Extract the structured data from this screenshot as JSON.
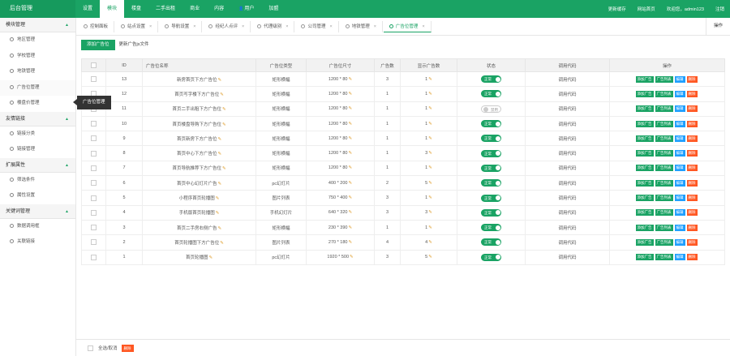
{
  "app": {
    "brand": "后台管理"
  },
  "topnav": [
    {
      "label": "设置",
      "active": false
    },
    {
      "label": "模块",
      "active": true
    },
    {
      "label": "楼盘",
      "active": false
    },
    {
      "label": "二手出租",
      "active": false
    },
    {
      "label": "商业",
      "active": false
    },
    {
      "label": "内容",
      "active": false
    },
    {
      "label": "用户",
      "active": false,
      "icon": "user-icon"
    },
    {
      "label": "加盟",
      "active": false
    }
  ],
  "topright": {
    "clear_cache": "更新缓存",
    "site_home": "网站首页",
    "welcome": "欢迎您，admin123",
    "logout": "注销"
  },
  "sidebar": {
    "groups": [
      {
        "title": "模块管理",
        "items": [
          {
            "label": "地区管理",
            "active": false
          },
          {
            "label": "学校管理",
            "active": false
          },
          {
            "label": "地铁管理",
            "active": false
          },
          {
            "label": "广告位管理",
            "active": true
          },
          {
            "label": "楼盘价管理",
            "active": false
          }
        ]
      },
      {
        "title": "友情链接",
        "items": [
          {
            "label": "链接分类",
            "active": false
          },
          {
            "label": "链接管理",
            "active": false
          }
        ]
      },
      {
        "title": "扩展属性",
        "items": [
          {
            "label": "筛选条件",
            "active": false
          },
          {
            "label": "属性设置",
            "active": false
          }
        ]
      },
      {
        "title": "关键词管理",
        "items": [
          {
            "label": "数据调用框",
            "active": false
          },
          {
            "label": "关联链接",
            "active": false
          }
        ]
      }
    ]
  },
  "tooltip": {
    "text": "广告位管理"
  },
  "tabs": [
    {
      "label": "控制面板",
      "active": false,
      "closable": false
    },
    {
      "label": "站点设置",
      "active": false,
      "closable": true
    },
    {
      "label": "导航设置",
      "active": false,
      "closable": true
    },
    {
      "label": "经纪人点评",
      "active": false,
      "closable": true
    },
    {
      "label": "代理级别",
      "active": false,
      "closable": true
    },
    {
      "label": "公司管理",
      "active": false,
      "closable": true
    },
    {
      "label": "地铁管理",
      "active": false,
      "closable": true
    },
    {
      "label": "广告位管理",
      "active": true,
      "closable": true
    }
  ],
  "tab_ops_label": "操作",
  "toolbar": {
    "add_label": "添加广告位",
    "refresh_label": "更新广告js文件"
  },
  "table": {
    "headers": [
      "",
      "ID",
      "广告位名称",
      "广告位类型",
      "广告位尺寸",
      "广告数",
      "显示广告数",
      "状态",
      "调用代码",
      "操作"
    ],
    "rows": [
      {
        "id": "13",
        "name": "新房首页下方广告位",
        "type": "矩形横幅",
        "size": "1200 * 80",
        "count": "3",
        "show": "1",
        "on": true,
        "code": "调用代码"
      },
      {
        "id": "12",
        "name": "首页写字楼下方广告位",
        "type": "矩形横幅",
        "size": "1200 * 80",
        "count": "1",
        "show": "1",
        "on": true,
        "code": "调用代码"
      },
      {
        "id": "11",
        "name": "首页二手出租下方广告位",
        "type": "矩形横幅",
        "size": "1200 * 80",
        "count": "1",
        "show": "1",
        "on": false,
        "code": "调用代码"
      },
      {
        "id": "10",
        "name": "首页楼盘导购下方广告位",
        "type": "矩形横幅",
        "size": "1200 * 80",
        "count": "1",
        "show": "1",
        "on": true,
        "code": "调用代码"
      },
      {
        "id": "9",
        "name": "首页新房下方广告位",
        "type": "矩形横幅",
        "size": "1200 * 80",
        "count": "1",
        "show": "1",
        "on": true,
        "code": "调用代码"
      },
      {
        "id": "8",
        "name": "首页中心下方广告位",
        "type": "矩形横幅",
        "size": "1200 * 80",
        "count": "1",
        "show": "3",
        "on": true,
        "code": "调用代码"
      },
      {
        "id": "7",
        "name": "首页导航推荐下方广告位",
        "type": "矩形横幅",
        "size": "1200 * 80",
        "count": "1",
        "show": "1",
        "on": true,
        "code": "调用代码"
      },
      {
        "id": "6",
        "name": "首页中心幻灯片广告",
        "type": "pc幻灯片",
        "size": "400 * 200",
        "count": "2",
        "show": "5",
        "on": true,
        "code": "调用代码"
      },
      {
        "id": "5",
        "name": "小程序首页轮播图",
        "type": "图片列表",
        "size": "750 * 400",
        "count": "3",
        "show": "1",
        "on": true,
        "code": "调用代码"
      },
      {
        "id": "4",
        "name": "手机版首页轮播图",
        "type": "手机幻灯片",
        "size": "640 * 320",
        "count": "3",
        "show": "3",
        "on": true,
        "code": "调用代码"
      },
      {
        "id": "3",
        "name": "首页二手房右侧广告",
        "type": "矩形横幅",
        "size": "230 * 390",
        "count": "1",
        "show": "1",
        "on": true,
        "code": "调用代码"
      },
      {
        "id": "2",
        "name": "首页轮播图下方广告位",
        "type": "图片列表",
        "size": "270 * 180",
        "count": "4",
        "show": "4",
        "on": true,
        "code": "调用代码"
      },
      {
        "id": "1",
        "name": "首页轮播图",
        "type": "pc幻灯片",
        "size": "1920 * 500",
        "count": "3",
        "show": "5",
        "on": true,
        "code": "调用代码"
      }
    ],
    "switch_on_label": "正常",
    "switch_off_label": "禁用",
    "ops": {
      "add": "添加广告",
      "list": "广告列表",
      "edit": "编辑",
      "delete": "删除"
    }
  },
  "footer": {
    "select_all_label": "全选/取消",
    "delete_label": "删除"
  },
  "colors": {
    "brand": "#1aa364",
    "blue": "#1e9fff",
    "danger": "#ff5722",
    "pencil": "#e0a030"
  }
}
